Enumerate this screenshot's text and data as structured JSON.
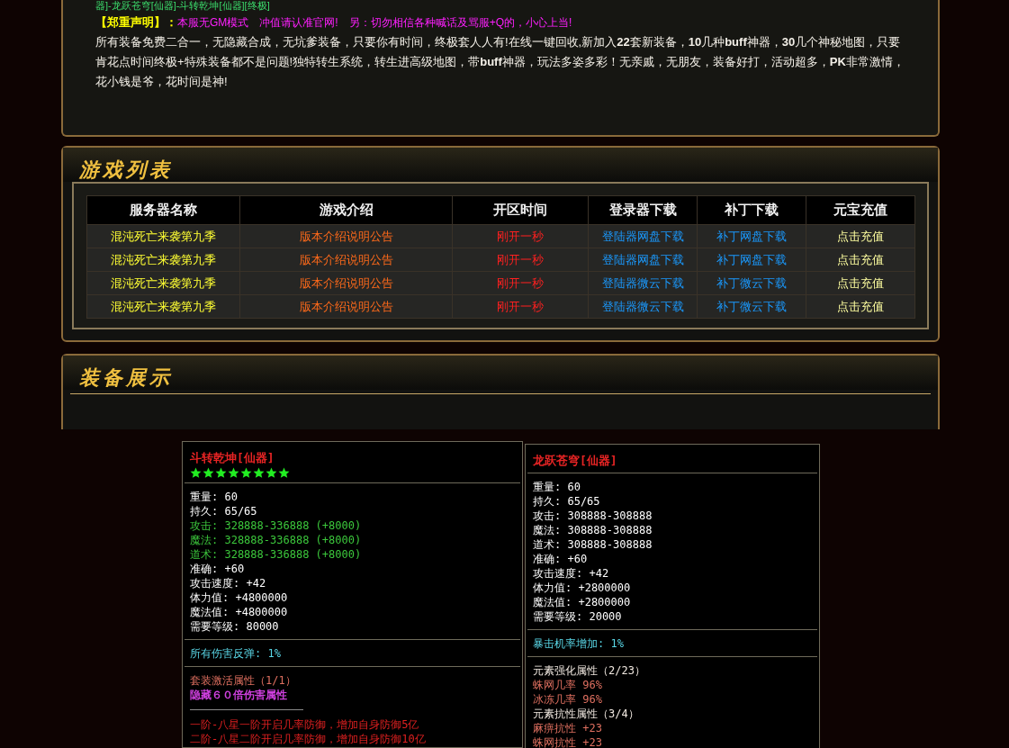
{
  "intro": {
    "top_line": "器]-龙跃苍穹[仙器]-斗转乾坤[仙器][终极]",
    "notice_label": "【郑重声明】：",
    "notice_text": "本服无GM模式　冲值请认准官网!　另：切勿相信各种喊话及骂服+Q的，小心上当!",
    "paragraph": "所有装备免费二合一，无隐藏合成，无坑爹装备，只要你有时间，终极套人人有!在线一键回收,新加入**22**套新装备，**10**几种**buff**神器，**30**几个神秘地图，只要肯花点时间终极+特殊装备都不是问题!独特转生系统，转生进高级地图，带**buff**神器，玩法多姿多彩！无亲戚，无朋友，装备好打，活动超多，**PK**非常激情，花小钱是爷，花时间是神!"
  },
  "game_list": {
    "title": "游戏列表",
    "columns": [
      "服务器名称",
      "游戏介绍",
      "开区时间",
      "登录器下载",
      "补丁下载",
      "元宝充值"
    ],
    "rows": [
      [
        "混沌死亡来袭第九季",
        "版本介绍说明公告",
        "刚开一秒",
        "登陆器网盘下载",
        "补丁网盘下载",
        "点击充值"
      ],
      [
        "混沌死亡来袭第九季",
        "版本介绍说明公告",
        "刚开一秒",
        "登陆器网盘下载",
        "补丁网盘下载",
        "点击充值"
      ],
      [
        "混沌死亡来袭第九季",
        "版本介绍说明公告",
        "刚开一秒",
        "登陆器微云下载",
        "补丁微云下载",
        "点击充值"
      ],
      [
        "混沌死亡来袭第九季",
        "版本介绍说明公告",
        "刚开一秒",
        "登陆器微云下载",
        "补丁微云下载",
        "点击充值"
      ]
    ]
  },
  "equipment": {
    "title": "装备展示",
    "items": [
      {
        "name": "斗转乾坤[仙器]",
        "stars": 8,
        "sections": [
          [
            {
              "kind": "text",
              "text": "重量: 60",
              "color": "#ffffff"
            },
            {
              "kind": "text",
              "text": "持久: 65/65",
              "color": "#ffffff"
            },
            {
              "kind": "text",
              "text": "攻击: 328888-336888 (+8000)",
              "color": "#3cc83c"
            },
            {
              "kind": "text",
              "text": "魔法: 328888-336888 (+8000)",
              "color": "#3cc83c"
            },
            {
              "kind": "text",
              "text": "道术: 328888-336888 (+8000)",
              "color": "#3cc83c"
            },
            {
              "kind": "text",
              "text": "准确: +60",
              "color": "#ffffff"
            },
            {
              "kind": "text",
              "text": "攻击速度: +42",
              "color": "#ffffff"
            },
            {
              "kind": "text",
              "text": "体力值: +4800000",
              "color": "#ffffff"
            },
            {
              "kind": "text",
              "text": "魔法值: +4800000",
              "color": "#ffffff"
            },
            {
              "kind": "text",
              "text": "需要等级: 80000",
              "color": "#ffffff"
            }
          ],
          [
            {
              "kind": "text",
              "text": "所有伤害反弹: 1%",
              "color": "#5ad8e8"
            }
          ],
          [
            {
              "kind": "text",
              "text": "套装激活属性（1/1）",
              "color": "#e07060"
            },
            {
              "kind": "strong",
              "text": "隐藏６０倍伤害属性",
              "color": "#d040e0"
            },
            {
              "kind": "rule"
            },
            {
              "kind": "text",
              "text": "一阶-八星一阶开启几率防御，增加自身防御5亿",
              "color": "#e02020"
            },
            {
              "kind": "text",
              "text": "二阶-八星二阶开启几率防御，增加自身防御10亿",
              "color": "#e02020"
            }
          ]
        ]
      },
      {
        "name": "龙跃苍穹[仙器]",
        "sections": [
          [
            {
              "kind": "text",
              "text": "重量: 60",
              "color": "#ffffff"
            },
            {
              "kind": "text",
              "text": "持久: 65/65",
              "color": "#ffffff"
            },
            {
              "kind": "text",
              "text": "攻击: 308888-308888",
              "color": "#ffffff"
            },
            {
              "kind": "text",
              "text": "魔法: 308888-308888",
              "color": "#ffffff"
            },
            {
              "kind": "text",
              "text": "道术: 308888-308888",
              "color": "#ffffff"
            },
            {
              "kind": "text",
              "text": "准确: +60",
              "color": "#ffffff"
            },
            {
              "kind": "text",
              "text": "攻击速度: +42",
              "color": "#ffffff"
            },
            {
              "kind": "text",
              "text": "体力值: +2800000",
              "color": "#ffffff"
            },
            {
              "kind": "text",
              "text": "魔法值: +2800000",
              "color": "#ffffff"
            },
            {
              "kind": "text",
              "text": "需要等级: 20000",
              "color": "#ffffff"
            }
          ],
          [
            {
              "kind": "text",
              "text": "暴击机率增加: 1%",
              "color": "#5ad8e8"
            }
          ],
          [
            {
              "kind": "text",
              "text": "元素强化属性（2/23）",
              "color": "#f0e8e0"
            },
            {
              "kind": "text",
              "text": "蛛网几率 96%",
              "color": "#e07060"
            },
            {
              "kind": "text",
              "text": "冰冻几率 96%",
              "color": "#e07060"
            },
            {
              "kind": "text",
              "text": "元素抗性属性（3/4）",
              "color": "#f0e8e0"
            },
            {
              "kind": "text",
              "text": "麻痹抗性 +23",
              "color": "#e07060"
            },
            {
              "kind": "text",
              "text": "蛛网抗性 +23",
              "color": "#e07060"
            }
          ]
        ]
      }
    ]
  }
}
